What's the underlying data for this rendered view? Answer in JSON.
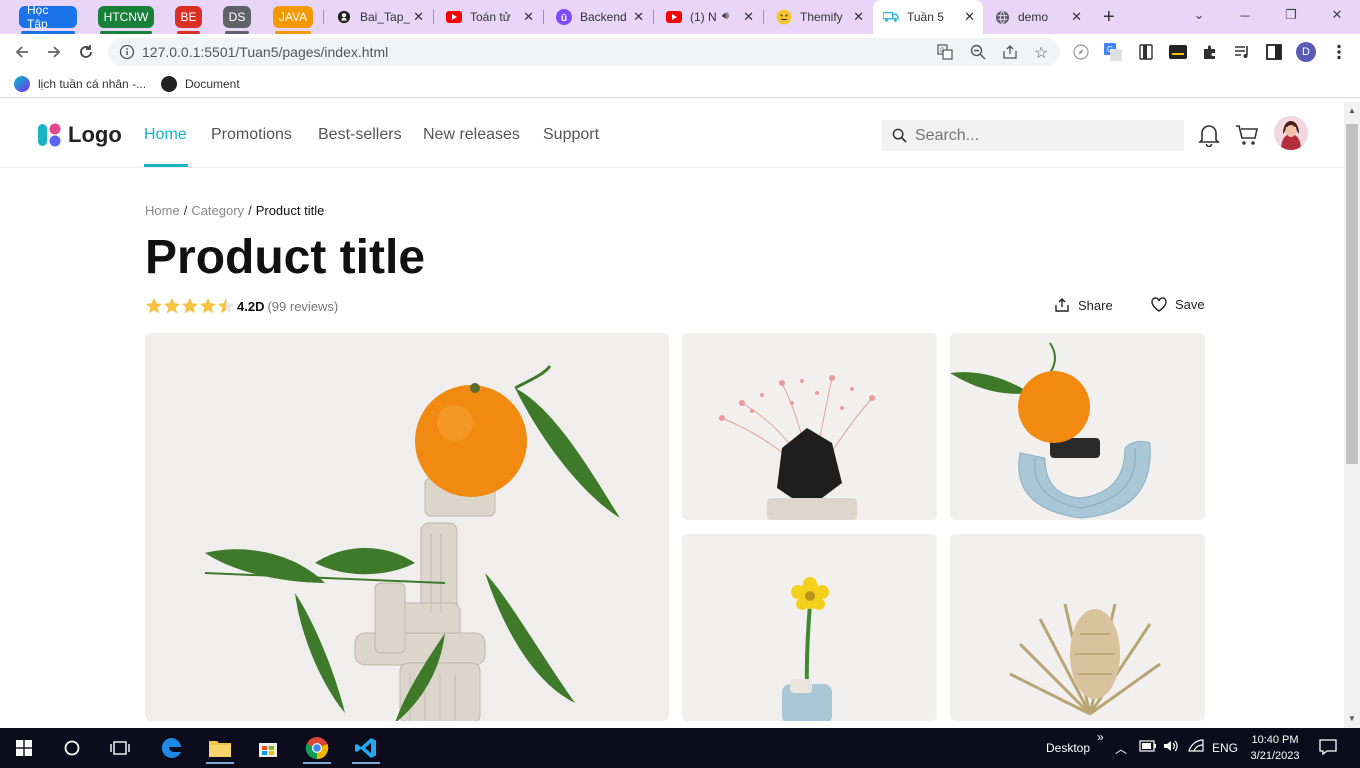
{
  "browser": {
    "tab_groups": [
      {
        "label": "Học Tập",
        "color": "#1a73e8"
      },
      {
        "label": "HTCNW",
        "color": "#188038"
      },
      {
        "label": "BE",
        "color": "#d93025"
      },
      {
        "label": "DS",
        "color": "#5f6368"
      },
      {
        "label": "JAVA",
        "color": "#f29900"
      }
    ],
    "tabs": [
      {
        "title": "Bai_Tap_",
        "icon": "github-icon"
      },
      {
        "title": "Toán tử",
        "icon": "youtube-icon"
      },
      {
        "title": "Backend",
        "icon": "udemy-icon"
      },
      {
        "title": "(1) N",
        "icon": "youtube-icon"
      },
      {
        "title": "Themify",
        "icon": "emoji-icon"
      },
      {
        "title": "Tuần 5",
        "icon": "live-server-icon"
      },
      {
        "title": "demo",
        "icon": "globe-icon"
      }
    ],
    "url": "127.0.0.1:5501/Tuan5/pages/index.html",
    "profile_initial": "D",
    "bookmarks": [
      {
        "label": "lịch tuần cá nhân -..."
      },
      {
        "label": "Document"
      }
    ]
  },
  "site": {
    "logo_text": "Logo",
    "nav": [
      "Home",
      "Promotions",
      "Best-sellers",
      "New releases",
      "Support"
    ],
    "search_placeholder": "Search..."
  },
  "product": {
    "breadcrumb": [
      "Home",
      "Category",
      "Product title"
    ],
    "title": "Product title",
    "rating_value": "4.2D",
    "rating_stars": 4.5,
    "reviews": "(99 reviews)",
    "share_label": "Share",
    "save_label": "Save"
  },
  "taskbar": {
    "desktop_label": "Desktop",
    "language": "ENG",
    "time": "10:40 PM",
    "date": "3/21/2023"
  }
}
